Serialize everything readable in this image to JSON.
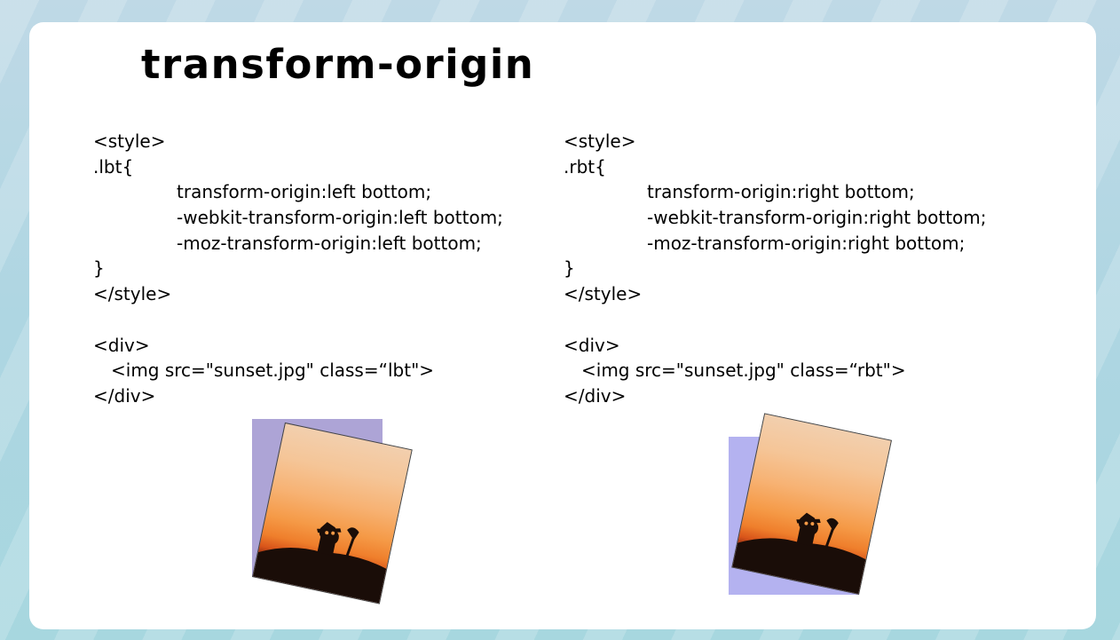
{
  "slide": {
    "title": "transform-origin"
  },
  "left_code": {
    "lines": [
      {
        "text": "<style>",
        "indent": 0
      },
      {
        "text": ".lbt{",
        "indent": 0
      },
      {
        "text": "transform-origin:left bottom;",
        "indent": 1
      },
      {
        "text": "-webkit-transform-origin:left bottom;",
        "indent": 1
      },
      {
        "text": "-moz-transform-origin:left bottom;",
        "indent": 1
      },
      {
        "text": "}",
        "indent": 0
      },
      {
        "text": "</style>",
        "indent": 0
      },
      {
        "text": "",
        "indent": 0
      },
      {
        "text": "<div>",
        "indent": 0
      },
      {
        "text": "<img src=\"sunset.jpg\" class=“lbt\">",
        "indent": 2
      },
      {
        "text": "</div>",
        "indent": 0
      }
    ]
  },
  "right_code": {
    "lines": [
      {
        "text": "<style>",
        "indent": 0
      },
      {
        "text": ".rbt{",
        "indent": 0
      },
      {
        "text": "transform-origin:right bottom;",
        "indent": 1
      },
      {
        "text": "-webkit-transform-origin:right bottom;",
        "indent": 1
      },
      {
        "text": "-moz-transform-origin:right bottom;",
        "indent": 1
      },
      {
        "text": "}",
        "indent": 0
      },
      {
        "text": "</style>",
        "indent": 0
      },
      {
        "text": "",
        "indent": 0
      },
      {
        "text": "<div>",
        "indent": 0
      },
      {
        "text": "<img src=\"sunset.jpg\" class=“rbt\">",
        "indent": 2
      },
      {
        "text": "</div>",
        "indent": 0
      }
    ]
  },
  "demos": {
    "left": {
      "origin": "left bottom",
      "rotation_deg": 12
    },
    "right": {
      "origin": "right bottom",
      "rotation_deg": 12
    }
  },
  "colors": {
    "ghost_left": "#ada4d6",
    "ghost_right": "#b4b2f0",
    "sky_top": "#f2cfae",
    "sky_bottom": "#ef7f2c",
    "ground": "#1a0d08"
  },
  "icons": {
    "photo": "sunset-photo-icon"
  }
}
